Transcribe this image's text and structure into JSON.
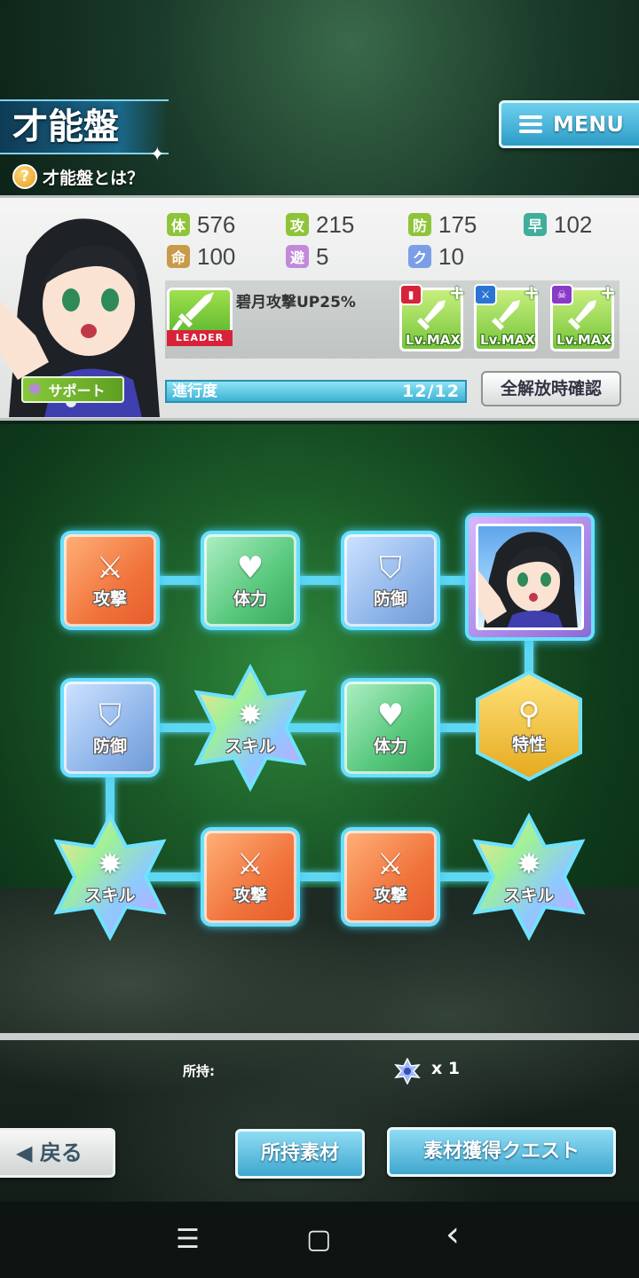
{
  "header": {
    "title": "才能盤",
    "help_text": "才能盤とは？",
    "menu_label": "MENU"
  },
  "stats": [
    {
      "label": "体",
      "value": "576",
      "color": "#8fc43a"
    },
    {
      "label": "攻",
      "value": "215",
      "color": "#8fc43a"
    },
    {
      "label": "防",
      "value": "175",
      "color": "#8fc43a"
    },
    {
      "label": "早",
      "value": "102",
      "color": "#3fae9a"
    },
    {
      "label": "命",
      "value": "100",
      "color": "#c89a4a"
    },
    {
      "label": "避",
      "value": "5",
      "color": "#c08ad8"
    },
    {
      "label": "ク",
      "value": "10",
      "color": "#7a9ee8"
    }
  ],
  "leader": {
    "tag": "LEADER",
    "skill_text": "碧月攻撃UP25%"
  },
  "passives": [
    {
      "level": "Lv.MAX",
      "mini_icon": "shield-badge",
      "mini_color": "#d8223a"
    },
    {
      "level": "Lv.MAX",
      "mini_icon": "sword-badge",
      "mini_color": "#2a74d4"
    },
    {
      "level": "Lv.MAX",
      "mini_icon": "skull-badge",
      "mini_color": "#8a3ac8"
    }
  ],
  "support_label": "サポート",
  "progress": {
    "label": "進行度",
    "count": "12/12",
    "fraction": 1.0
  },
  "confirm_label": "全解放時確認",
  "board": {
    "row1": [
      {
        "type": "attack",
        "label": "攻撃",
        "icon": "sword-icon"
      },
      {
        "type": "hp",
        "label": "体力",
        "icon": "heart-icon"
      },
      {
        "type": "defense",
        "label": "防御",
        "icon": "shield-icon"
      }
    ],
    "row2": [
      {
        "type": "defense",
        "label": "防御",
        "icon": "shield-icon"
      },
      {
        "type": "skill",
        "label": "スキル",
        "icon": "burst-icon"
      },
      {
        "type": "hp",
        "label": "体力",
        "icon": "heart-icon"
      },
      {
        "type": "trait",
        "label": "特性",
        "icon": "keyhole-icon"
      }
    ],
    "row3": [
      {
        "type": "skill",
        "label": "スキル",
        "icon": "burst-icon"
      },
      {
        "type": "attack",
        "label": "攻撃",
        "icon": "sword-icon"
      },
      {
        "type": "attack",
        "label": "攻撃",
        "icon": "sword-icon"
      },
      {
        "type": "skill",
        "label": "スキル",
        "icon": "burst-icon"
      }
    ]
  },
  "owned": {
    "label": "所持:",
    "count": "x 1"
  },
  "buttons": {
    "back": "戻る",
    "owned_materials": "所持素材",
    "material_quest": "素材獲得クエスト"
  },
  "nav": {
    "menu": "☰",
    "home": "▢",
    "back": "‹"
  }
}
